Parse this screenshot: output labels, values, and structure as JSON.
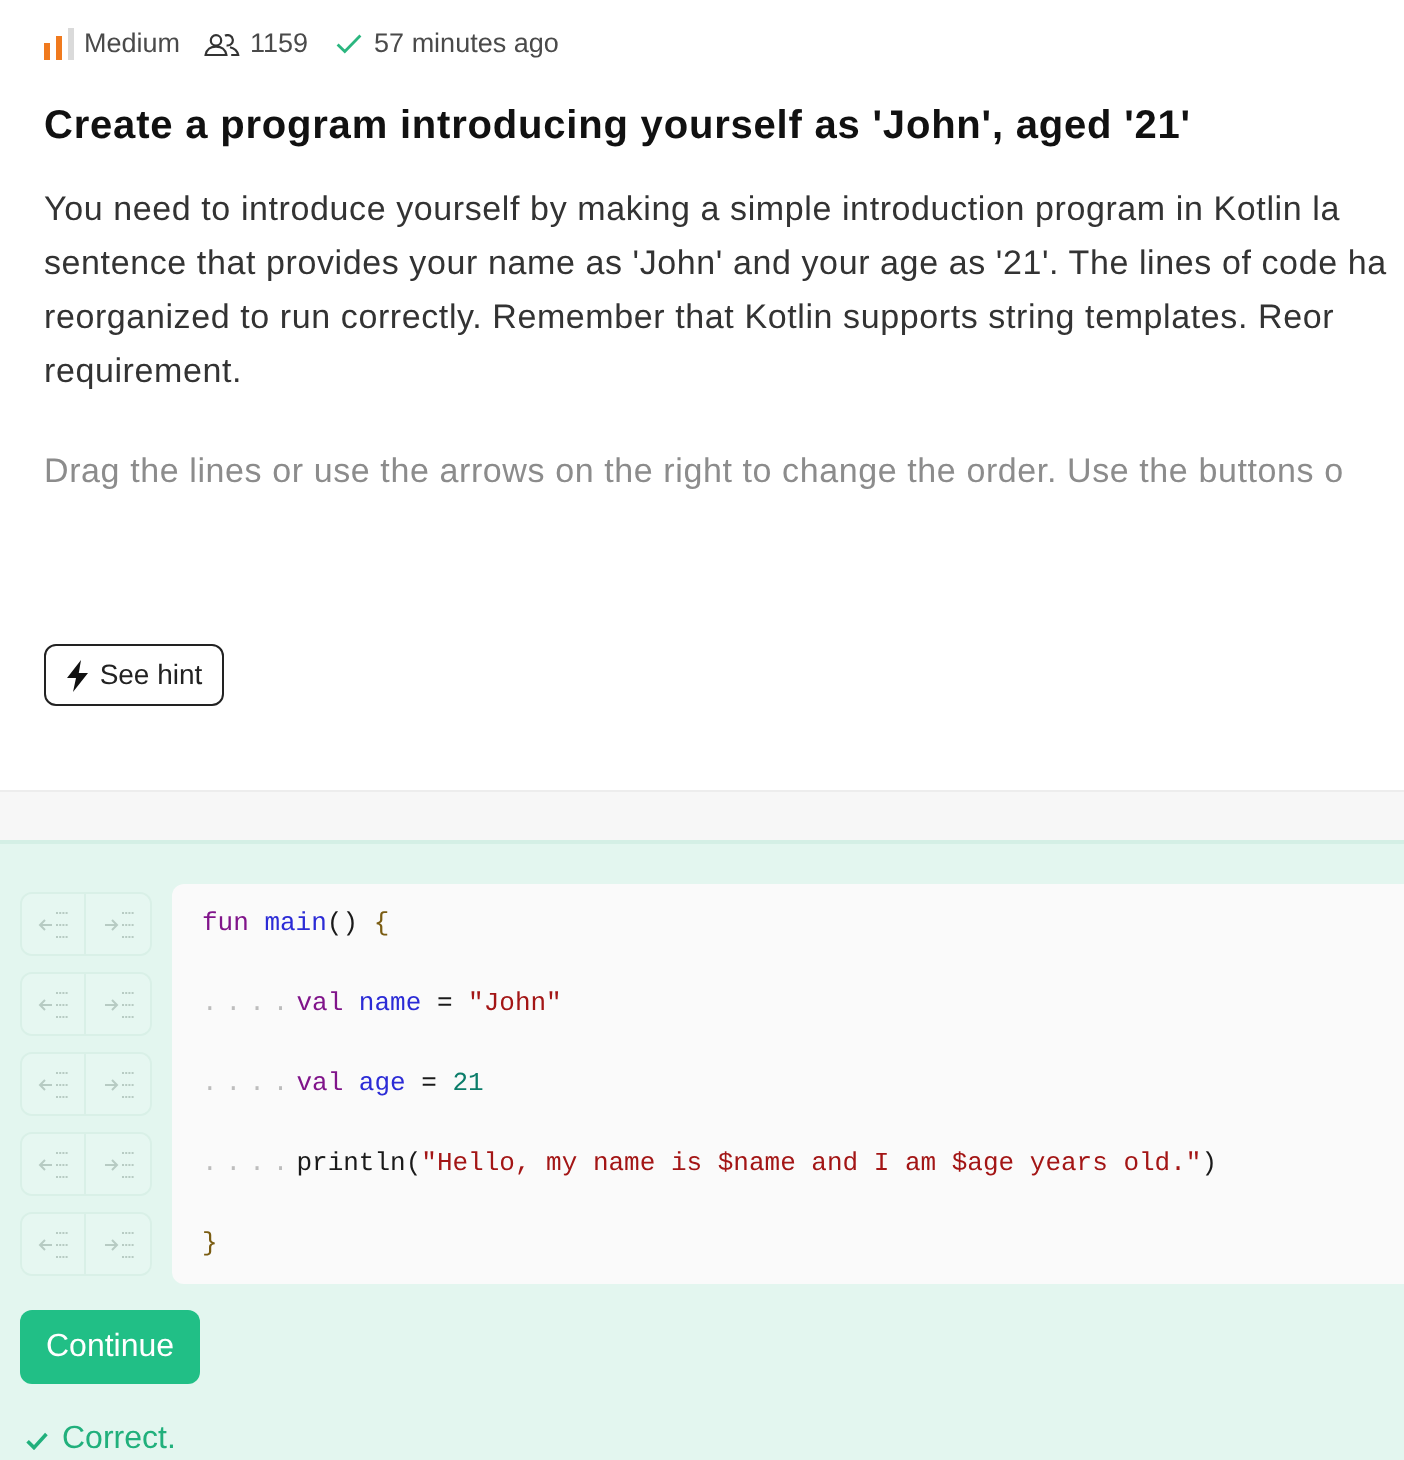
{
  "meta": {
    "difficulty": {
      "label": "Medium",
      "level": 0.67
    },
    "learners": "1159",
    "solved_time": "57 minutes ago"
  },
  "title": "Create a program introducing yourself as 'John', aged '21'",
  "description_lines": [
    "You need to introduce yourself by making a simple introduction program in Kotlin la",
    "sentence that provides your name as 'John' and your age as '21'. The lines of code ha",
    "reorganized to run correctly. Remember that Kotlin supports string templates. Reor",
    "requirement."
  ],
  "instruction": "Drag the lines or use the arrows on the right to change the order. Use the buttons o",
  "hint_button": "See hint",
  "code_lines": [
    {
      "tokens": [
        {
          "kind": "keyword",
          "text": "fun"
        },
        {
          "kind": "name",
          "text": " main"
        },
        {
          "kind": "plain",
          "text": "() "
        },
        {
          "kind": "brace",
          "text": "{"
        }
      ]
    },
    {
      "indent": "....",
      "tokens": [
        {
          "kind": "keyword",
          "text": "val"
        },
        {
          "kind": "name",
          "text": " name"
        },
        {
          "kind": "plain",
          "text": " = "
        },
        {
          "kind": "string",
          "text": "\"John\""
        }
      ]
    },
    {
      "indent": "....",
      "tokens": [
        {
          "kind": "keyword",
          "text": "val"
        },
        {
          "kind": "name",
          "text": " age"
        },
        {
          "kind": "plain",
          "text": " = "
        },
        {
          "kind": "number",
          "text": "21"
        }
      ]
    },
    {
      "indent": "....",
      "tokens": [
        {
          "kind": "plain",
          "text": "println("
        },
        {
          "kind": "string",
          "text": "\"Hello, my name is $name and I am $age years old.\""
        },
        {
          "kind": "plain",
          "text": ")"
        }
      ]
    },
    {
      "tokens": [
        {
          "kind": "brace",
          "text": "}"
        }
      ]
    }
  ],
  "continue_button": "Continue",
  "result": {
    "correct": true,
    "text": "Correct."
  }
}
